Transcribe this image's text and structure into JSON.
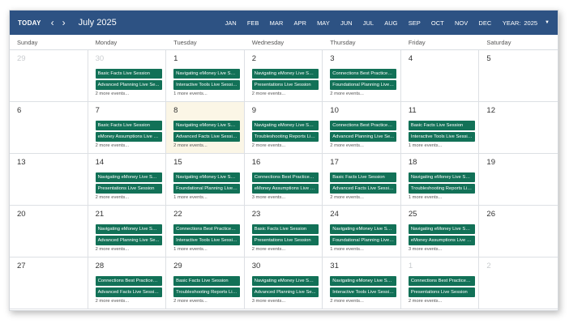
{
  "toolbar": {
    "today_label": "TODAY",
    "prev_label": "‹",
    "next_label": "›",
    "month_title": "July 2025",
    "months": [
      "JAN",
      "FEB",
      "MAR",
      "APR",
      "MAY",
      "JUN",
      "JUL",
      "AUG",
      "SEP",
      "OCT",
      "NOV",
      "DEC"
    ],
    "year_label": "YEAR:",
    "year_value": "2025",
    "year_caret": "▼"
  },
  "colors": {
    "header": "#2d5283",
    "event": "#127157",
    "today_bg": "#fbf6e6"
  },
  "weekdays": [
    "Sunday",
    "Monday",
    "Tuesday",
    "Wednesday",
    "Thursday",
    "Friday",
    "Saturday"
  ],
  "weeks": [
    [
      {
        "day": "29",
        "muted": true,
        "events": [],
        "more": ""
      },
      {
        "day": "30",
        "muted": true,
        "events": [
          "Basic Facts Live Session",
          "Advanced Planning Live Se..."
        ],
        "more": "2 more events..."
      },
      {
        "day": "1",
        "events": [
          "Navigating eMoney Live Ses...",
          "Interactive Tools Live Session"
        ],
        "more": "1 more events..."
      },
      {
        "day": "2",
        "events": [
          "Navigating eMoney Live Ses...",
          "Presentations Live Session"
        ],
        "more": "2 more events..."
      },
      {
        "day": "3",
        "events": [
          "Connections Best Practices ...",
          "Foundational Planning Live ..."
        ],
        "more": "2 more events..."
      },
      {
        "day": "4",
        "events": [],
        "more": ""
      },
      {
        "day": "5",
        "events": [],
        "more": ""
      }
    ],
    [
      {
        "day": "6",
        "events": [],
        "more": ""
      },
      {
        "day": "7",
        "events": [
          "Basic Facts Live Session",
          "eMoney Assumptions Live S..."
        ],
        "more": "2 more events..."
      },
      {
        "day": "8",
        "today": true,
        "events": [
          "Navigating eMoney Live Ses...",
          "Advanced Facts Live Session"
        ],
        "more": "2 more events..."
      },
      {
        "day": "9",
        "events": [
          "Navigating eMoney Live Ses...",
          "Troubleshooting Reports Liv..."
        ],
        "more": "2 more events..."
      },
      {
        "day": "10",
        "events": [
          "Connections Best Practices ...",
          "Advanced Planning Live Se..."
        ],
        "more": "2 more events..."
      },
      {
        "day": "11",
        "events": [
          "Basic Facts Live Session",
          "Interactive Tools Live Session"
        ],
        "more": "1 more events..."
      },
      {
        "day": "12",
        "events": [],
        "more": ""
      }
    ],
    [
      {
        "day": "13",
        "events": [],
        "more": ""
      },
      {
        "day": "14",
        "events": [
          "Navigating eMoney Live Ses...",
          "Presentations Live Session"
        ],
        "more": "2 more events..."
      },
      {
        "day": "15",
        "events": [
          "Navigating eMoney Live Ses...",
          "Foundational Planning Live ..."
        ],
        "more": "1 more events..."
      },
      {
        "day": "16",
        "events": [
          "Connections Best Practices ...",
          "eMoney Assumptions Live S..."
        ],
        "more": "3 more events..."
      },
      {
        "day": "17",
        "events": [
          "Basic Facts Live Session",
          "Advanced Facts Live Session"
        ],
        "more": "2 more events..."
      },
      {
        "day": "18",
        "events": [
          "Navigating eMoney Live Ses...",
          "Troubleshooting Reports Liv..."
        ],
        "more": "1 more events..."
      },
      {
        "day": "19",
        "events": [],
        "more": ""
      }
    ],
    [
      {
        "day": "20",
        "events": [],
        "more": ""
      },
      {
        "day": "21",
        "events": [
          "Navigating eMoney Live Ses...",
          "Advanced Planning Live Se..."
        ],
        "more": "2 more events..."
      },
      {
        "day": "22",
        "events": [
          "Connections Best Practices ...",
          "Interactive Tools Live Session"
        ],
        "more": "1 more events..."
      },
      {
        "day": "23",
        "events": [
          "Basic Facts Live Session",
          "Presentations Live Session"
        ],
        "more": "2 more events..."
      },
      {
        "day": "24",
        "events": [
          "Navigating eMoney Live Ses...",
          "Foundational Planning Live ..."
        ],
        "more": "1 more events..."
      },
      {
        "day": "25",
        "events": [
          "Navigating eMoney Live Ses...",
          "eMoney Assumptions Live S..."
        ],
        "more": "3 more events..."
      },
      {
        "day": "26",
        "events": [],
        "more": ""
      }
    ],
    [
      {
        "day": "27",
        "events": [],
        "more": ""
      },
      {
        "day": "28",
        "events": [
          "Connections Best Practices ...",
          "Advanced Facts Live Session"
        ],
        "more": "2 more events..."
      },
      {
        "day": "29",
        "events": [
          "Basic Facts Live Session",
          "Troubleshooting Reports Liv..."
        ],
        "more": "2 more events..."
      },
      {
        "day": "30",
        "events": [
          "Navigating eMoney Live Ses...",
          "Advanced Planning Live Se..."
        ],
        "more": "3 more events..."
      },
      {
        "day": "31",
        "events": [
          "Navigating eMoney Live Ses...",
          "Interactive Tools Live Session"
        ],
        "more": "2 more events..."
      },
      {
        "day": "1",
        "muted": true,
        "events": [
          "Connections Best Practices ...",
          "Presentations Live Session"
        ],
        "more": "2 more events..."
      },
      {
        "day": "2",
        "muted": true,
        "events": [],
        "more": ""
      }
    ]
  ]
}
